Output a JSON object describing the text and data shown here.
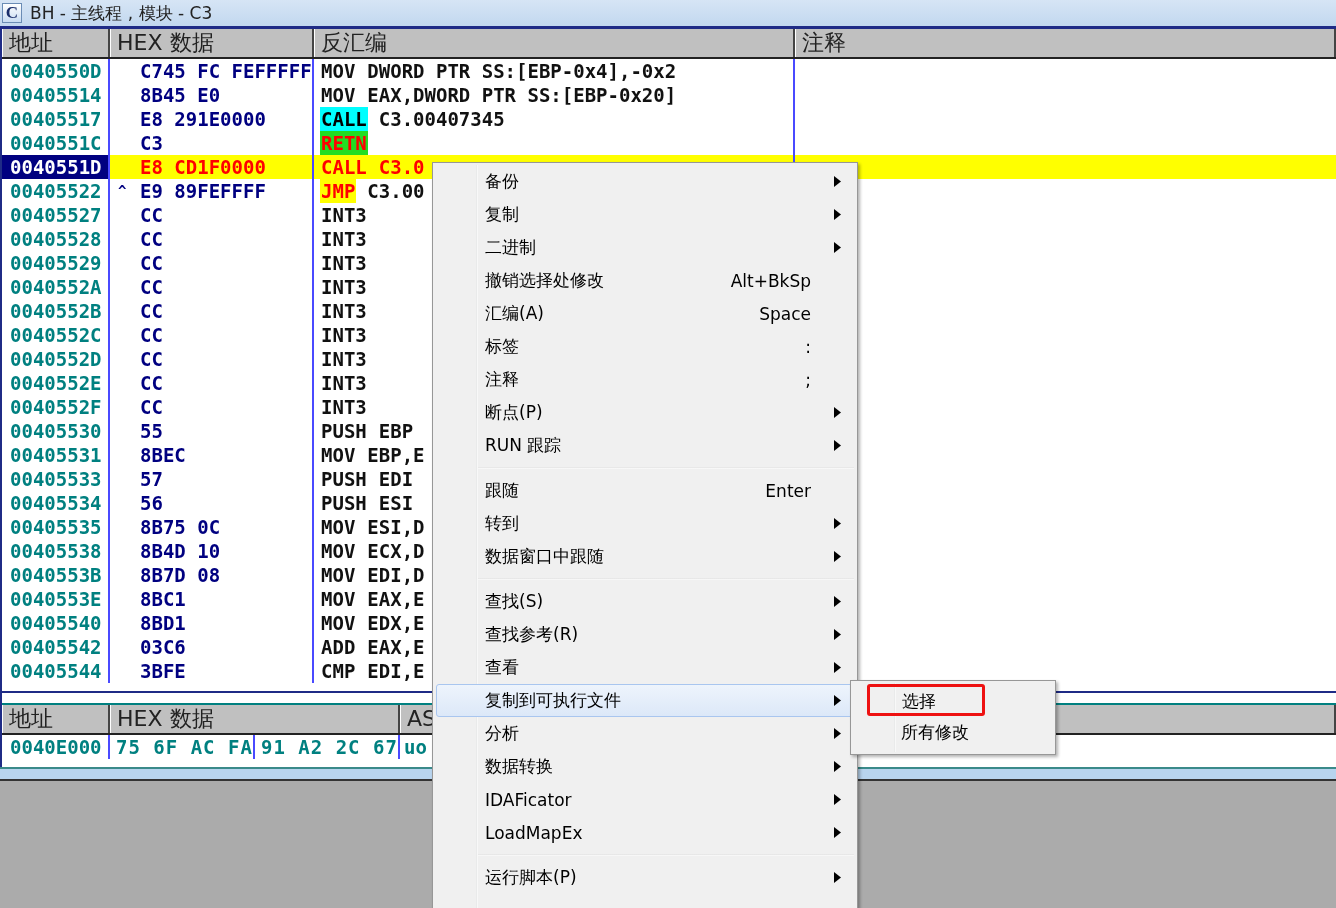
{
  "window": {
    "icon_text": "C",
    "title": "BH - 主线程 , 模块 - C3"
  },
  "disassembly": {
    "columns": [
      "地址",
      "HEX 数据",
      "反汇编",
      "注释"
    ],
    "rows": [
      {
        "address": "0040550D",
        "hex": "C745 FC FEFFFFF",
        "mnemonic": "MOV",
        "operands": "DWORD PTR SS:[EBP-0x4],-0x2",
        "kind": "plain",
        "selected": false
      },
      {
        "address": "00405514",
        "hex": "8B45 E0",
        "mnemonic": "MOV",
        "operands": "EAX,DWORD PTR SS:[EBP-0x20]",
        "kind": "plain",
        "selected": false
      },
      {
        "address": "00405517",
        "hex": "E8 291E0000",
        "mnemonic": "CALL",
        "operands": "C3.00407345",
        "kind": "call",
        "selected": false
      },
      {
        "address": "0040551C",
        "hex": "C3",
        "mnemonic": "RETN",
        "kind": "retn",
        "selected": false
      },
      {
        "address": "0040551D",
        "hex": "E8 CD1F0000",
        "mnemonic": "CALL",
        "operands": "C3.0",
        "kind": "call",
        "selected": true
      },
      {
        "address": "00405522",
        "jump_mark": "^",
        "hex": "E9 89FEFFFF",
        "mnemonic": "JMP",
        "operands": "C3.00",
        "kind": "jmp",
        "selected": false
      },
      {
        "address": "00405527",
        "hex": "CC",
        "mnemonic": "INT3",
        "kind": "plain",
        "selected": false
      },
      {
        "address": "00405528",
        "hex": "CC",
        "mnemonic": "INT3",
        "kind": "plain",
        "selected": false
      },
      {
        "address": "00405529",
        "hex": "CC",
        "mnemonic": "INT3",
        "kind": "plain",
        "selected": false
      },
      {
        "address": "0040552A",
        "hex": "CC",
        "mnemonic": "INT3",
        "kind": "plain",
        "selected": false
      },
      {
        "address": "0040552B",
        "hex": "CC",
        "mnemonic": "INT3",
        "kind": "plain",
        "selected": false
      },
      {
        "address": "0040552C",
        "hex": "CC",
        "mnemonic": "INT3",
        "kind": "plain",
        "selected": false
      },
      {
        "address": "0040552D",
        "hex": "CC",
        "mnemonic": "INT3",
        "kind": "plain",
        "selected": false
      },
      {
        "address": "0040552E",
        "hex": "CC",
        "mnemonic": "INT3",
        "kind": "plain",
        "selected": false
      },
      {
        "address": "0040552F",
        "hex": "CC",
        "mnemonic": "INT3",
        "kind": "plain",
        "selected": false
      },
      {
        "address": "00405530",
        "hex": "55",
        "mnemonic": "PUSH",
        "operands": "EBP",
        "kind": "plain",
        "selected": false
      },
      {
        "address": "00405531",
        "hex": "8BEC",
        "mnemonic": "MOV",
        "operands": "EBP,E",
        "kind": "plain",
        "selected": false
      },
      {
        "address": "00405533",
        "hex": "57",
        "mnemonic": "PUSH",
        "operands": "EDI",
        "kind": "plain",
        "selected": false
      },
      {
        "address": "00405534",
        "hex": "56",
        "mnemonic": "PUSH",
        "operands": "ESI",
        "kind": "plain",
        "selected": false
      },
      {
        "address": "00405535",
        "hex": "8B75 0C",
        "mnemonic": "MOV",
        "operands": "ESI,D",
        "kind": "plain",
        "selected": false
      },
      {
        "address": "00405538",
        "hex": "8B4D 10",
        "mnemonic": "MOV",
        "operands": "ECX,D",
        "kind": "plain",
        "selected": false
      },
      {
        "address": "0040553B",
        "hex": "8B7D 08",
        "mnemonic": "MOV",
        "operands": "EDI,D",
        "kind": "plain",
        "selected": false
      },
      {
        "address": "0040553E",
        "hex": "8BC1",
        "mnemonic": "MOV",
        "operands": "EAX,E",
        "kind": "plain",
        "selected": false
      },
      {
        "address": "00405540",
        "hex": "8BD1",
        "mnemonic": "MOV",
        "operands": "EDX,E",
        "kind": "plain",
        "selected": false
      },
      {
        "address": "00405542",
        "hex": "03C6",
        "mnemonic": "ADD",
        "operands": "EAX,E",
        "kind": "plain",
        "selected": false
      },
      {
        "address": "00405544",
        "hex": "3BFE",
        "mnemonic": "CMP",
        "operands": "EDI,E",
        "kind": "plain",
        "selected": false
      }
    ]
  },
  "dump": {
    "columns": [
      "地址",
      "HEX 数据",
      "AS"
    ],
    "rows": [
      {
        "address": "0040E000",
        "hex_1": "75 6F AC FA",
        "hex_2": "91 A2 2C 67",
        "ascii": "uo"
      }
    ]
  },
  "context_menu": {
    "items": [
      {
        "kind": "item",
        "label": "备份",
        "submenu": true,
        "selected": false
      },
      {
        "kind": "item",
        "label": "复制",
        "submenu": true,
        "selected": false
      },
      {
        "kind": "item",
        "label": "二进制",
        "submenu": true,
        "selected": false
      },
      {
        "kind": "item",
        "label": "撤销选择处修改",
        "shortcut": "Alt+BkSp",
        "submenu": false,
        "selected": false
      },
      {
        "kind": "item",
        "label": "汇编(A)",
        "shortcut": "Space",
        "submenu": false,
        "selected": false
      },
      {
        "kind": "item",
        "label": "标签",
        "shortcut": ":",
        "submenu": false,
        "selected": false
      },
      {
        "kind": "item",
        "label": "注释",
        "shortcut": ";",
        "submenu": false,
        "selected": false
      },
      {
        "kind": "item",
        "label": "断点(P)",
        "submenu": true,
        "selected": false
      },
      {
        "kind": "item",
        "label": "RUN 跟踪",
        "submenu": true,
        "selected": false
      },
      {
        "kind": "separator"
      },
      {
        "kind": "item",
        "label": "跟随",
        "shortcut": "Enter",
        "submenu": false,
        "selected": false
      },
      {
        "kind": "item",
        "label": "转到",
        "submenu": true,
        "selected": false
      },
      {
        "kind": "item",
        "label": "数据窗口中跟随",
        "submenu": true,
        "selected": false
      },
      {
        "kind": "separator"
      },
      {
        "kind": "item",
        "label": "查找(S)",
        "submenu": true,
        "selected": false
      },
      {
        "kind": "item",
        "label": "查找参考(R)",
        "submenu": true,
        "selected": false
      },
      {
        "kind": "item",
        "label": "查看",
        "submenu": true,
        "selected": false
      },
      {
        "kind": "item",
        "label": "复制到可执行文件",
        "submenu": true,
        "selected": true
      },
      {
        "kind": "item",
        "label": "分析",
        "submenu": true,
        "selected": false
      },
      {
        "kind": "item",
        "label": "数据转换",
        "submenu": true,
        "selected": false
      },
      {
        "kind": "item",
        "label": "IDAFicator",
        "submenu": true,
        "selected": false
      },
      {
        "kind": "item",
        "label": "LoadMapEx",
        "submenu": true,
        "selected": false
      },
      {
        "kind": "separator"
      },
      {
        "kind": "item",
        "label": "运行脚本(P)",
        "submenu": true,
        "selected": false
      }
    ]
  },
  "submenu": {
    "items": [
      {
        "label": "选择",
        "marked": true
      },
      {
        "label": "所有修改",
        "marked": false
      }
    ]
  }
}
